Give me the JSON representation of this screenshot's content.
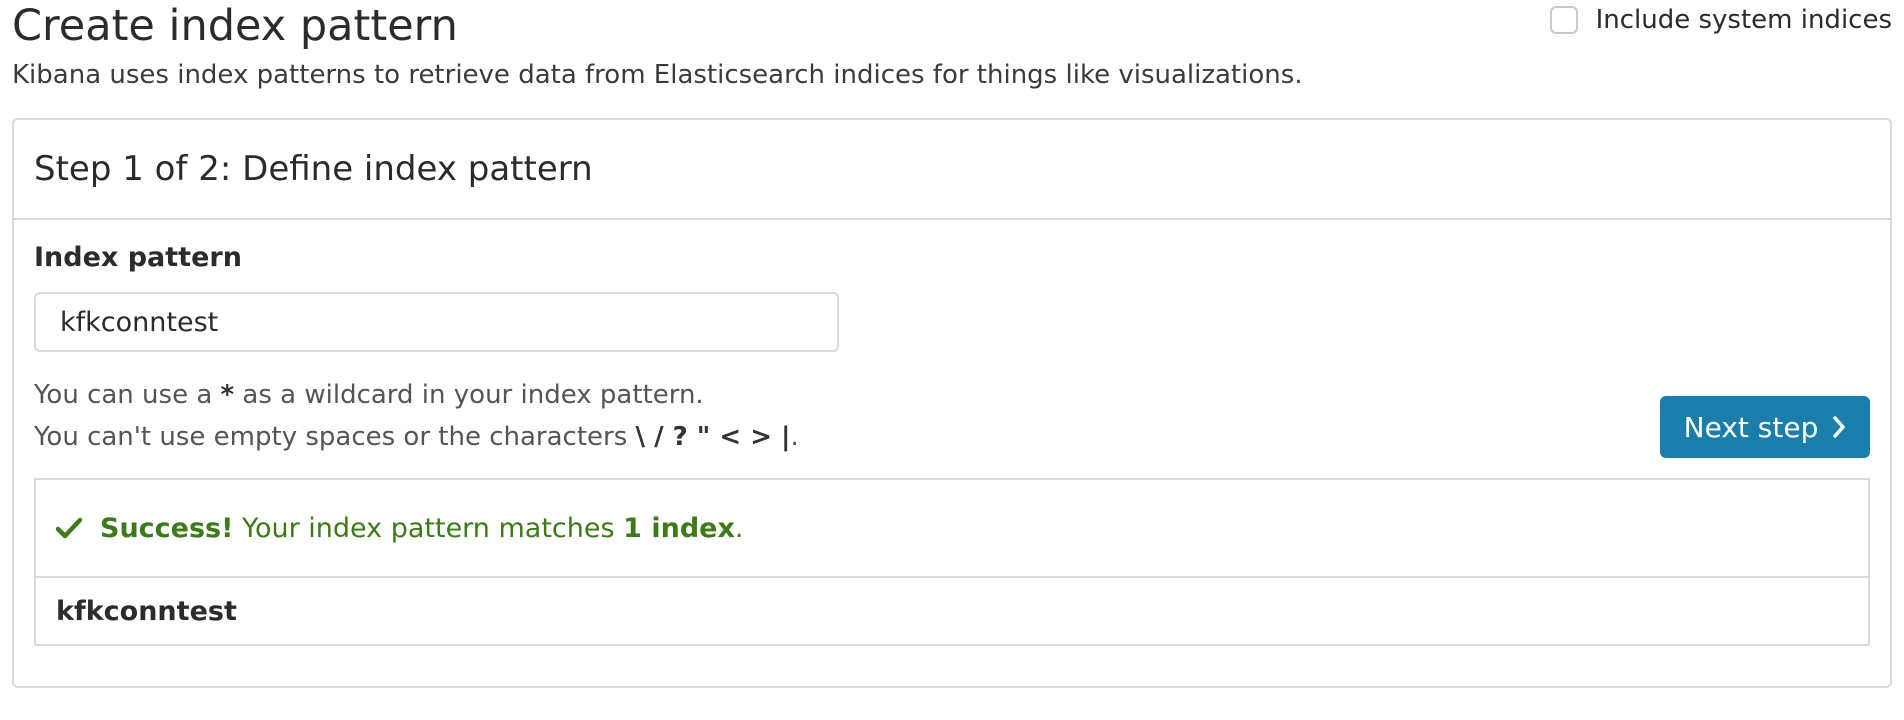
{
  "header": {
    "title": "Create index pattern",
    "subtitle": "Kibana uses index patterns to retrieve data from Elasticsearch indices for things like visualizations.",
    "include_system_indices_label": "Include system indices",
    "include_system_indices_checked": false
  },
  "step": {
    "title": "Step 1 of 2: Define index pattern",
    "field_label": "Index pattern",
    "input_value": "kfkconntest",
    "help_line1_prefix": "You can use a ",
    "help_line1_bold": "*",
    "help_line1_suffix": " as a wildcard in your index pattern.",
    "help_line2_prefix": "You can't use empty spaces or the characters ",
    "help_line2_bold": "\\ / ? \" < > |",
    "help_line2_suffix": ".",
    "next_button_label": "Next step"
  },
  "result": {
    "success_bold": "Success!",
    "success_text": " Your index pattern matches ",
    "match_count_text": "1 index",
    "success_end": ".",
    "indices": [
      "kfkconntest"
    ]
  },
  "icons": {
    "next": "chevron-right-icon",
    "success": "check-icon"
  },
  "colors": {
    "primary_button": "#1b7dac",
    "success_text": "#3d7a18",
    "border": "#d9d9d9"
  }
}
